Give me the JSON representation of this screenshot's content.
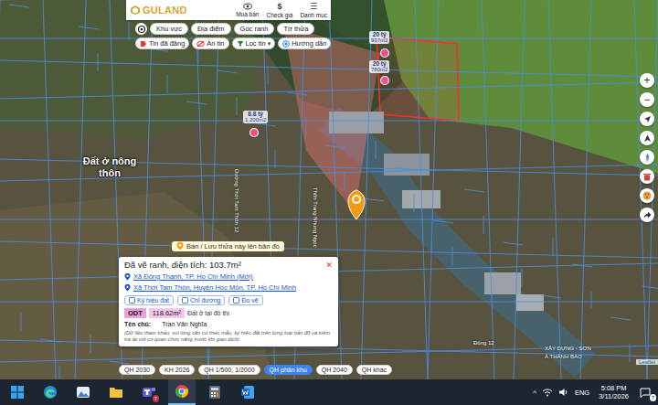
{
  "header": {
    "logo": "GULAND",
    "nav": [
      {
        "label": "Mua bán",
        "kind": "eye"
      },
      {
        "label": "Check giá",
        "kind": "glyph",
        "glyph": "$"
      },
      {
        "label": "Danh mục",
        "kind": "glyph",
        "glyph": "☰"
      }
    ]
  },
  "search_modes": [
    {
      "label": "Khu vực",
      "selected": false
    },
    {
      "label": "Địa điểm",
      "selected": false
    },
    {
      "label": "Góc ranh",
      "selected": false
    },
    {
      "label": "Tờ thửa",
      "selected": false
    }
  ],
  "filters": [
    {
      "label": "Tin đã đăng",
      "kind": "tag",
      "color": "#e53935"
    },
    {
      "label": "Ẩn tin",
      "kind": "hide",
      "color": "#e53935"
    },
    {
      "label": "Lọc tin",
      "kind": "filter",
      "color": "#2e7d32",
      "caret": "▾"
    },
    {
      "label": "Hướng dẫn",
      "kind": "help",
      "color": "#1e88e5"
    }
  ],
  "map": {
    "pins": [
      {
        "price": "20 tỷ",
        "area": "937m2"
      },
      {
        "price": "20 tỷ",
        "area": "780m2"
      },
      {
        "price": "8.8 tỷ",
        "area": "1.200m2"
      }
    ],
    "zone_label": "Đất ở nông thôn",
    "street_labels": [
      "Đường Thới Tam Thôn 12",
      "Thôn Trang Nhung Ngọc",
      "Đông 12",
      "XÂY DỰNG - SƠN",
      "À THÀNH BẢO"
    ],
    "save_banner": "Bán / Lưu thửa này lên bản đồ",
    "zoom": {
      "in": "+",
      "out": "−"
    },
    "attribution": "Leaflet"
  },
  "info_card": {
    "title": "Đã vẽ ranh, diện tích: 103.7m²",
    "close": "✕",
    "addresses": [
      "Xã Đông Thạnh, TP. Hồ Chí Minh (Mới)",
      "Xã Thới Tam Thôn, Huyện Hóc Môn, TP. Hồ Chí Minh"
    ],
    "actions": [
      "Ký hiệu đất",
      "Chỉ đường",
      "Đo vẽ"
    ],
    "land": {
      "code": "ODT",
      "area": "118.62m²",
      "name": "Đất ở tại đô thị"
    },
    "owner_label": "Tên chủ:",
    "owner": "Trần Văn Nghĩa",
    "note": "(Dữ liệu tham khảo, vui lòng căn cứ theo mẫu, ký hiệu đất trên từng loại bản đồ và kiểm tra lại với cơ quan chức năng trước khi giao dịch)"
  },
  "plan_layers": [
    {
      "label": "QH 2030",
      "selected": false
    },
    {
      "label": "KH 2026",
      "selected": false
    },
    {
      "label": "QH 1/500, 1/2000",
      "selected": false
    },
    {
      "label": "QH phân khu",
      "selected": true
    },
    {
      "label": "QH 2040",
      "selected": false
    },
    {
      "label": "QH khác",
      "selected": false
    }
  ],
  "taskbar": {
    "apps": [
      {
        "kind": "edge",
        "selected": false
      },
      {
        "kind": "photos",
        "selected": false
      },
      {
        "kind": "folder",
        "selected": false
      },
      {
        "kind": "teams",
        "selected": false,
        "badge": "7"
      },
      {
        "kind": "chrome",
        "selected": true
      },
      {
        "kind": "calculator",
        "selected": false
      },
      {
        "kind": "word",
        "selected": false
      }
    ],
    "overflow": "^",
    "language": "ENG",
    "time": "5:08 PM",
    "date": "3/11/2026",
    "notifications": "7"
  }
}
